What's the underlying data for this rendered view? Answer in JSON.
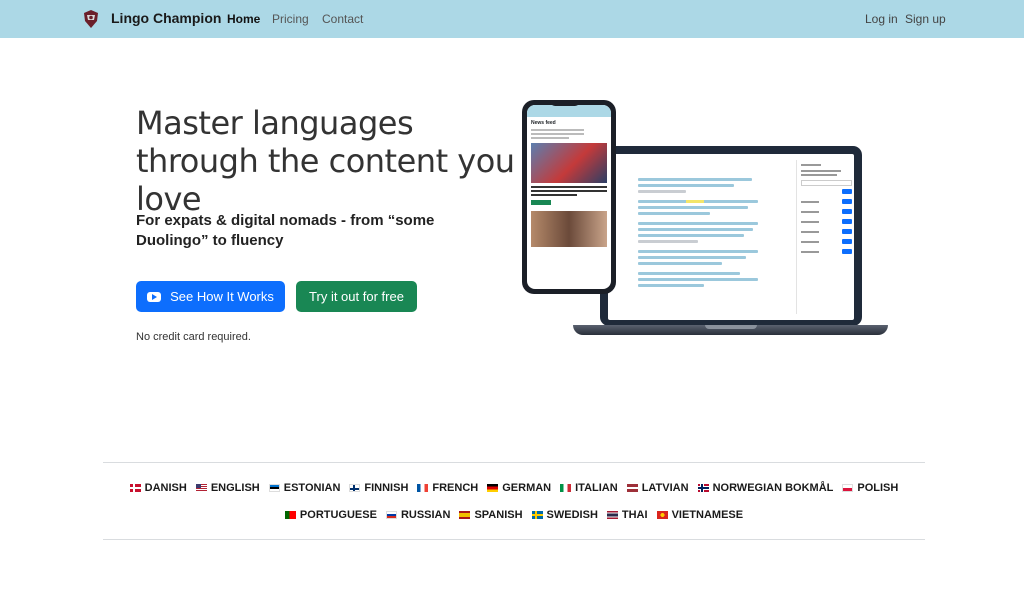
{
  "nav": {
    "brand": "Lingo Champion",
    "links": [
      "Home",
      "Pricing",
      "Contact"
    ],
    "login": "Log in",
    "signup": "Sign up"
  },
  "hero": {
    "title": "Master languages through the content you love",
    "subtitle": "For expats & digital nomads - from “some Duolingo” to fluency",
    "btn_how": "See How It Works",
    "btn_try": "Try it out for free",
    "note": "No credit card required."
  },
  "phone": {
    "feed_title": "News feed"
  },
  "languages": {
    "row1": [
      "DANISH",
      "ENGLISH",
      "ESTONIAN",
      "FINNISH",
      "FRENCH",
      "GERMAN",
      "ITALIAN",
      "LATVIAN",
      "NORWEGIAN BOKMÅL",
      "POLISH"
    ],
    "row2": [
      "PORTUGUESE",
      "RUSSIAN",
      "SPANISH",
      "SWEDISH",
      "THAI",
      "VIETNAMESE"
    ]
  },
  "colors": {
    "navbar": "#acd8e6",
    "primary": "#0d6efd",
    "success": "#198754"
  }
}
